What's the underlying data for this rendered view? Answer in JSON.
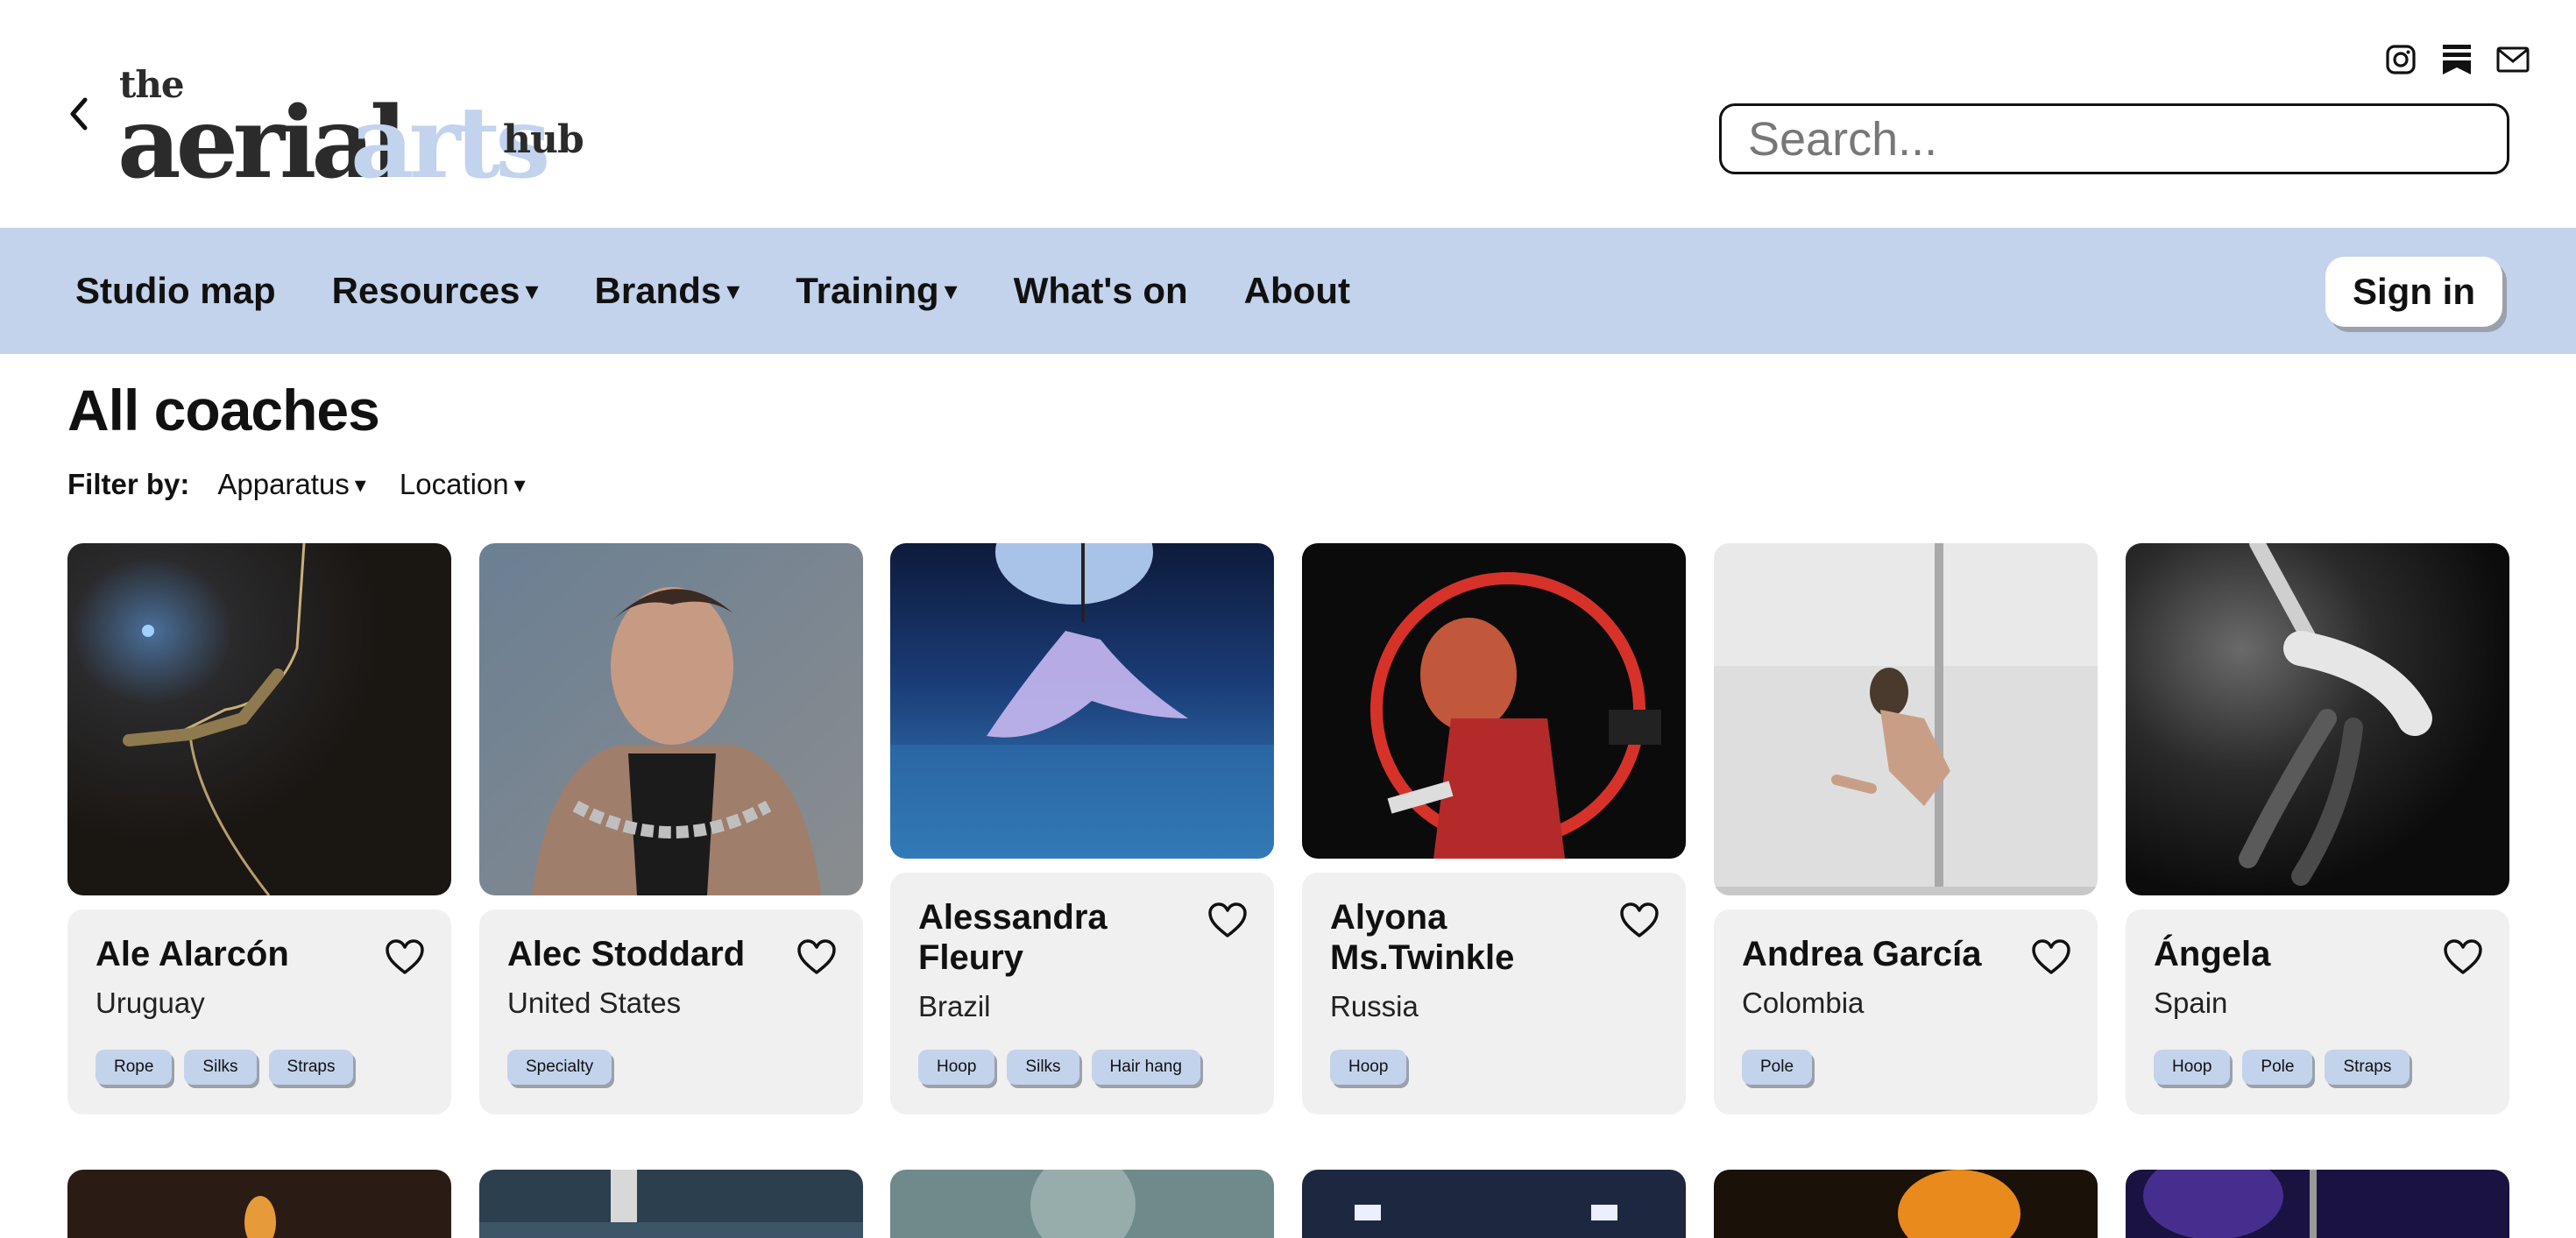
{
  "header": {
    "logo": {
      "the": "the",
      "aerial": "aerial",
      "arts": "arts",
      "hub": "hub"
    },
    "search_placeholder": "Search...",
    "social_icons": [
      "instagram-icon",
      "substack-icon",
      "mail-icon"
    ]
  },
  "nav": {
    "items": [
      {
        "label": "Studio map",
        "dropdown": false
      },
      {
        "label": "Resources",
        "dropdown": true
      },
      {
        "label": "Brands",
        "dropdown": true
      },
      {
        "label": "Training",
        "dropdown": true
      },
      {
        "label": "What's on",
        "dropdown": false
      },
      {
        "label": "About",
        "dropdown": false
      }
    ],
    "caret": "▾",
    "signin_label": "Sign in"
  },
  "main": {
    "title": "All coaches",
    "filter_label": "Filter by:",
    "filters": [
      "Apparatus",
      "Location"
    ]
  },
  "coaches": [
    {
      "name": "Ale Alarcón",
      "country": "Uruguay",
      "tags": [
        "Rope",
        "Silks",
        "Straps"
      ]
    },
    {
      "name": "Alec Stoddard",
      "country": "United States",
      "tags": [
        "Specialty"
      ]
    },
    {
      "name": "Alessandra Fleury",
      "country": "Brazil",
      "tags": [
        "Hoop",
        "Silks",
        "Hair hang"
      ]
    },
    {
      "name": "Alyona Ms.Twinkle",
      "country": "Russia",
      "tags": [
        "Hoop"
      ]
    },
    {
      "name": "Andrea García",
      "country": "Colombia",
      "tags": [
        "Pole"
      ]
    },
    {
      "name": "Ángela",
      "country": "Spain",
      "tags": [
        "Hoop",
        "Pole",
        "Straps"
      ]
    }
  ],
  "colors": {
    "accent": "#c3d3ec",
    "card_bg": "#f0f0f0",
    "text": "#111111"
  }
}
